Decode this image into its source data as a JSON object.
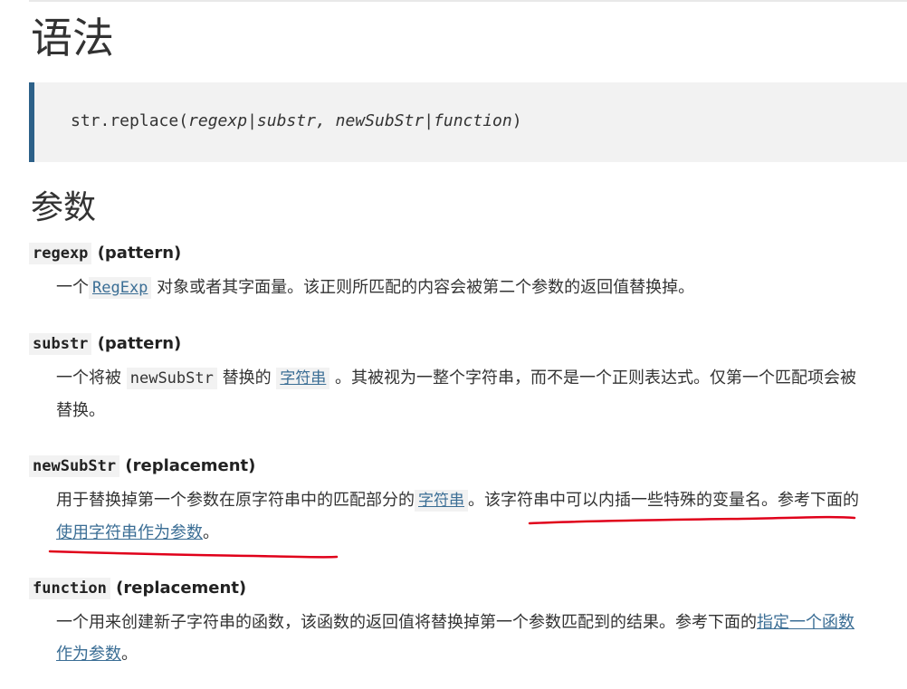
{
  "page": {
    "heading_syntax": "语法",
    "heading_params": "参数"
  },
  "syntax": {
    "obj": "str.replace(",
    "arg1": "regexp",
    "sep1": "|",
    "arg2": "substr",
    "comma": ", ",
    "arg3": "newSubStr",
    "sep2": "|",
    "arg4": "function",
    "close": ")"
  },
  "params": [
    {
      "name": "regexp",
      "type": " (pattern)",
      "t1": "一个",
      "link": "RegExp",
      "t2": " 对象或者其字面量。该正则所匹配的内容会被第二个参数的返回值替换掉。"
    },
    {
      "name": "substr",
      "type": " (pattern)",
      "t1": "一个将被 ",
      "code": "newSubStr",
      "t2": " 替换的 ",
      "link": "字符串",
      "t3": " 。其被视为一整个字符串，而不是一个正则表达式。仅第一个匹配项会被替换。"
    },
    {
      "name": "newSubStr",
      "type": " (replacement)",
      "t1": "用于替换掉第一个参数在原字符串中的匹配部分的",
      "link": "字符串",
      "t2": "。该字符串中可以内插一些特殊的变量名。参考下面的",
      "link2": "使用字符串作为参数",
      "t3": "。"
    },
    {
      "name": "function",
      "type": " (replacement)",
      "t1": "一个用来创建新子字符串的函数，该函数的返回值将替换掉第一个参数匹配到的结果。参考下面的",
      "link": "指定一个函数作为参数",
      "t2": "。"
    }
  ],
  "colors": {
    "link": "#3b6e95",
    "annotation": "#e0001a",
    "code_bg": "#f2f2f2",
    "syntax_border": "#2d6189"
  }
}
